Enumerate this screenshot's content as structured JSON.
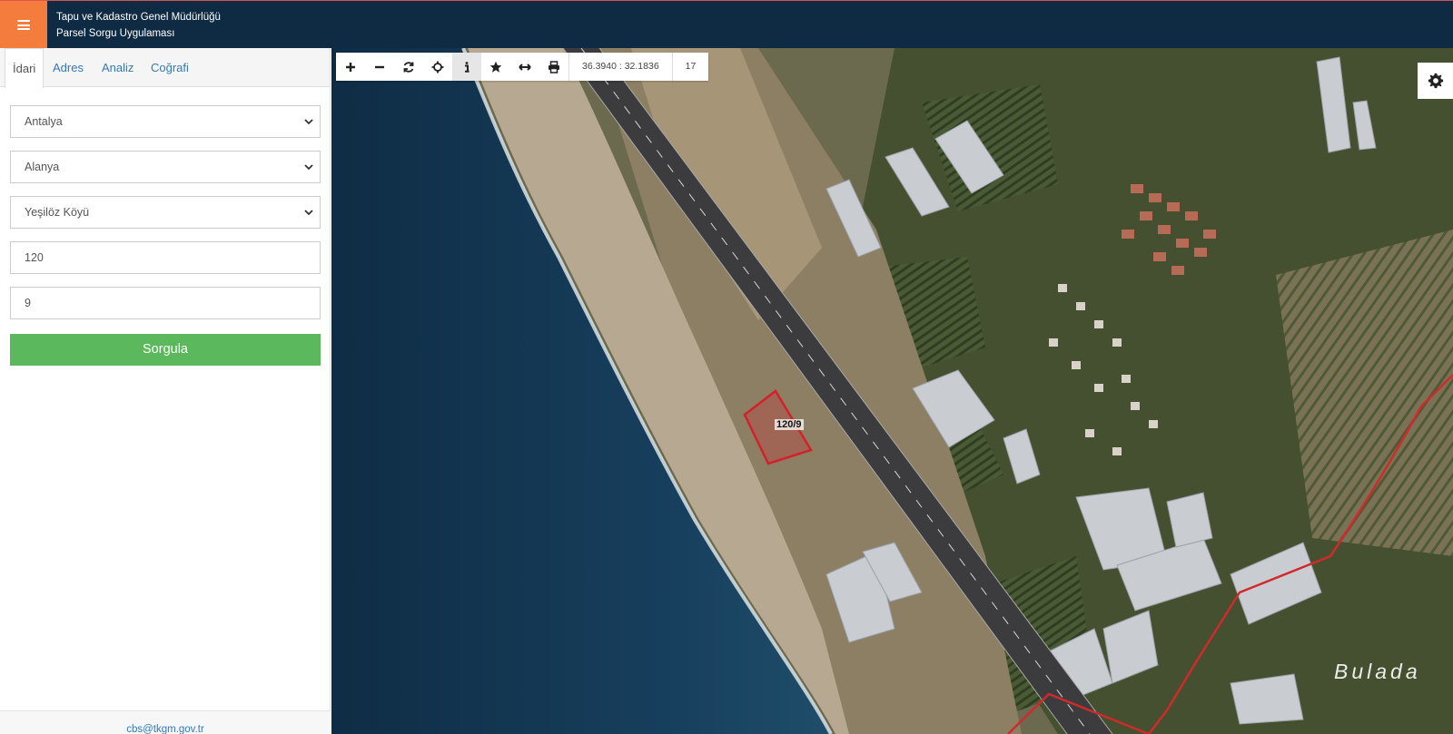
{
  "header": {
    "title_line1": "Tapu ve Kadastro Genel Müdürlüğü",
    "title_line2": "Parsel Sorgu Uygulaması",
    "menu_icon": "hamburger-icon"
  },
  "sidebar": {
    "tabs": [
      {
        "label": "İdari",
        "active": true
      },
      {
        "label": "Adres",
        "active": false
      },
      {
        "label": "Analiz",
        "active": false
      },
      {
        "label": "Coğrafi",
        "active": false
      }
    ],
    "province": {
      "value": "Antalya"
    },
    "district": {
      "value": "Alanya"
    },
    "neighborhood": {
      "value": "Yeşilöz Köyü"
    },
    "block_no": {
      "value": "120"
    },
    "parcel_no": {
      "value": "9"
    },
    "query_button": "Sorgula",
    "footer_email": "cbs@tkgm.gov.tr"
  },
  "map": {
    "toolbar": {
      "icons": [
        "zoom-in-icon",
        "zoom-out-icon",
        "refresh-icon",
        "locate-icon",
        "info-icon",
        "star-icon",
        "measure-icon",
        "print-icon"
      ],
      "selected_tool": "info-icon",
      "coordinates": "36.3940 : 32.1836",
      "zoom_level": "17"
    },
    "settings_icon": "gear-icon",
    "parcel_label": "120/9",
    "place_label": "Bulada",
    "colors": {
      "sea": "#143650",
      "beach": "#b7a892",
      "road": "#3c3c3e",
      "parcel_outline": "#d4202b",
      "boundary": "#d02a2a"
    }
  },
  "colors": {
    "header_bg": "#0f2b44",
    "menu_button": "#f47c3c",
    "query_button": "#5cb85c",
    "link": "#337ab7"
  }
}
